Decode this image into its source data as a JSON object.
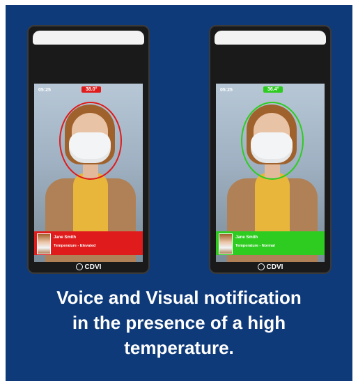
{
  "colors": {
    "background": "#0f3a7a",
    "alert": "#e01b1b",
    "normal": "#2ecc20"
  },
  "devices": [
    {
      "time": "05:25",
      "temperature": "38.0°",
      "person_name": "Jane Smith",
      "status_text": "Temperature - Elevated",
      "state": "elevated",
      "logo_text": "CDVI",
      "logo_icon": "cdvi-logo-icon"
    },
    {
      "time": "05:25",
      "temperature": "36.4°",
      "person_name": "Jane Smith",
      "status_text": "Temperature - Normal",
      "state": "normal",
      "logo_text": "CDVI",
      "logo_icon": "cdvi-logo-icon"
    }
  ],
  "caption": {
    "line1": "Voice and Visual notification",
    "line2": "in the presence of a high",
    "line3": "temperature."
  }
}
